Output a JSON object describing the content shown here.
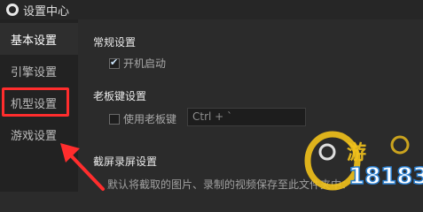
{
  "window": {
    "title": "设置中心",
    "icon": "app-logo-icon"
  },
  "sidebar": {
    "items": [
      {
        "label": "基本设置",
        "active": true
      },
      {
        "label": "引擎设置",
        "active": false
      },
      {
        "label": "机型设置",
        "active": false
      },
      {
        "label": "游戏设置",
        "active": false
      }
    ]
  },
  "general": {
    "title": "常规设置",
    "autostart_label": "开机启动",
    "autostart_checked": true
  },
  "bosskey": {
    "title": "老板键设置",
    "use_label": "使用老板键",
    "use_checked": false,
    "hotkey_value": "Ctrl + `"
  },
  "capture": {
    "title": "截屏录屏设置",
    "description": "默认将截取的图片、录制的视频保存至此文件夹中："
  },
  "annotation": {
    "highlight_color": "#ff2d2d"
  },
  "watermark": {
    "text": "9游18183"
  }
}
